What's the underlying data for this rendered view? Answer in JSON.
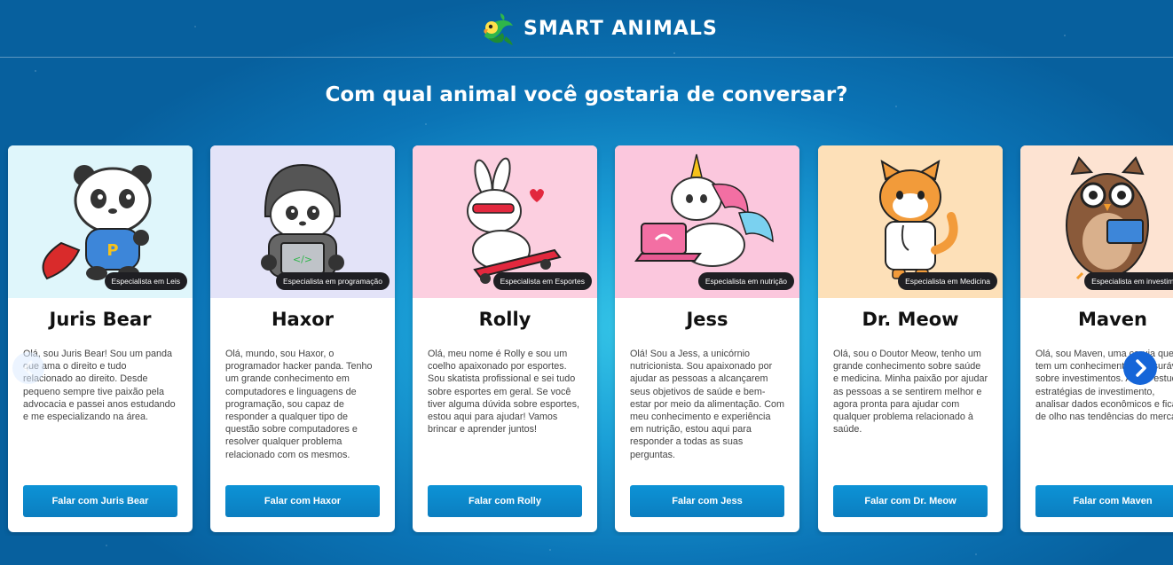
{
  "brand": {
    "name": "SMART ANIMALS",
    "logo_icon": "parrot-icon"
  },
  "headline": "Com qual animal você gostaria de conversar?",
  "colors": {
    "accent": "#0d93d6",
    "next_arrow": "#1565d8",
    "badge_bg": "#1f1f23"
  },
  "cards": [
    {
      "name": "Juris Bear",
      "badge": "Especialista em Leis",
      "bg": "#dff6fb",
      "desc": "Olá, sou Juris Bear! Sou um panda que ama o direito e tudo relacionado ao direito. Desde pequeno sempre tive paixão pela advocacia e passei anos estudando e me especializando na área.",
      "button": "Falar com Juris Bear",
      "icon": "superhero-panda-icon"
    },
    {
      "name": "Haxor",
      "badge": "Especialista em programação",
      "bg": "#e3e3f8",
      "desc": "Olá, mundo, sou Haxor, o programador hacker panda. Tenho um grande conhecimento em computadores e linguagens de programação, sou capaz de responder a qualquer tipo de questão sobre computadores e resolver qualquer problema relacionado com os mesmos.",
      "button": "Falar com Haxor",
      "icon": "hacker-panda-icon"
    },
    {
      "name": "Rolly",
      "badge": "Especialista em Esportes",
      "bg": "#fccfe0",
      "desc": "Olá, meu nome é Rolly e sou um coelho apaixonado por esportes. Sou skatista profissional e sei tudo sobre esportes em geral. Se você tiver alguma dúvida sobre esportes, estou aqui para ajudar! Vamos brincar e aprender juntos!",
      "button": "Falar com Rolly",
      "icon": "skater-bunny-icon"
    },
    {
      "name": "Jess",
      "badge": "Especialista em nutrição",
      "bg": "#fbc7dd",
      "desc": "Olá! Sou a Jess, a unicórnio nutricionista. Sou apaixonado por ajudar as pessoas a alcançarem seus objetivos de saúde e bem-estar por meio da alimentação. Com meu conhecimento e experiência em nutrição, estou aqui para responder a todas as suas perguntas.",
      "button": "Falar com Jess",
      "icon": "unicorn-laptop-icon"
    },
    {
      "name": "Dr. Meow",
      "badge": "Especialista em Medicina",
      "bg": "#fde0b8",
      "desc": "Olá, sou o Doutor Meow, tenho um grande conhecimento sobre saúde e medicina. Minha paixão por ajudar as pessoas a se sentirem melhor e agora pronta para ajudar com qualquer problema relacionado à saúde.",
      "button": "Falar com Dr. Meow",
      "icon": "doctor-cat-icon"
    },
    {
      "name": "Maven",
      "badge": "Especialista em investimentos",
      "bg": "#fde3d2",
      "desc": "Olá, sou Maven, uma coruja que tem um conhecimento imensurável sobre investimentos. Adoro estudar estratégias de investimento, analisar dados econômicos e ficar de olho nas tendências do mercado.",
      "button": "Falar com Maven",
      "icon": "owl-book-icon"
    }
  ],
  "nav": {
    "prev_icon": "chevron-left-icon",
    "next_icon": "chevron-right-icon"
  }
}
